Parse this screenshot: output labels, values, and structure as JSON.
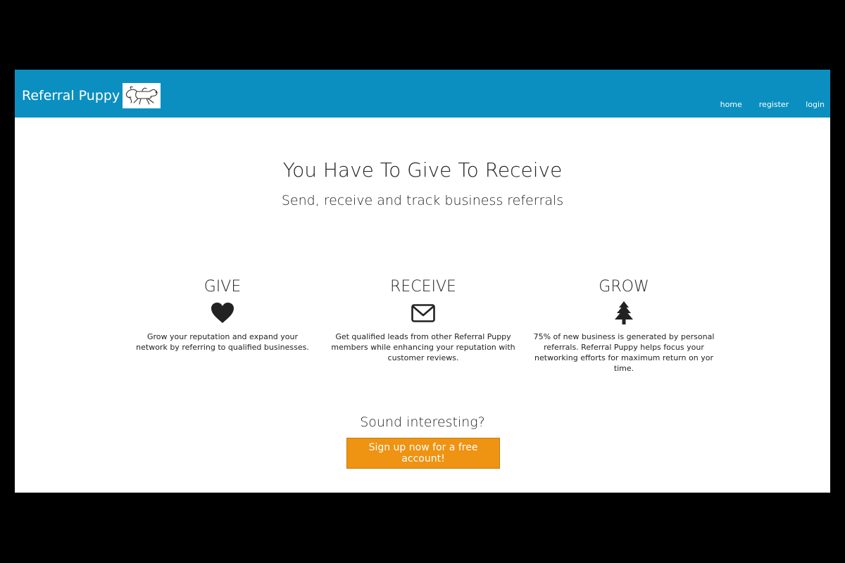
{
  "navbar": {
    "brand": "Referral Puppy",
    "links": [
      {
        "label": "home"
      },
      {
        "label": "register"
      },
      {
        "label": "login"
      }
    ]
  },
  "hero": {
    "title": "You Have To Give To Receive",
    "subtitle": "Send, receive and track business referrals"
  },
  "features": [
    {
      "title": "GIVE",
      "icon": "heart-icon",
      "text": "Grow your reputation and expand your network by referring to qualified businesses."
    },
    {
      "title": "RECEIVE",
      "icon": "envelope-icon",
      "text": "Get qualified leads from other Referral Puppy members while enhancing your reputation with customer reviews."
    },
    {
      "title": "GROW",
      "icon": "tree-icon",
      "text": "75% of new business is generated by personal referrals. Referral Puppy helps focus your networking efforts for maximum return on yor time."
    }
  ],
  "cta": {
    "question": "Sound interesting?",
    "button_label": "Sign up now for a free account!"
  },
  "colors": {
    "navbar": "#0b8fc0",
    "button": "#ee9312",
    "text": "#222222",
    "letterbox": "#000000"
  }
}
